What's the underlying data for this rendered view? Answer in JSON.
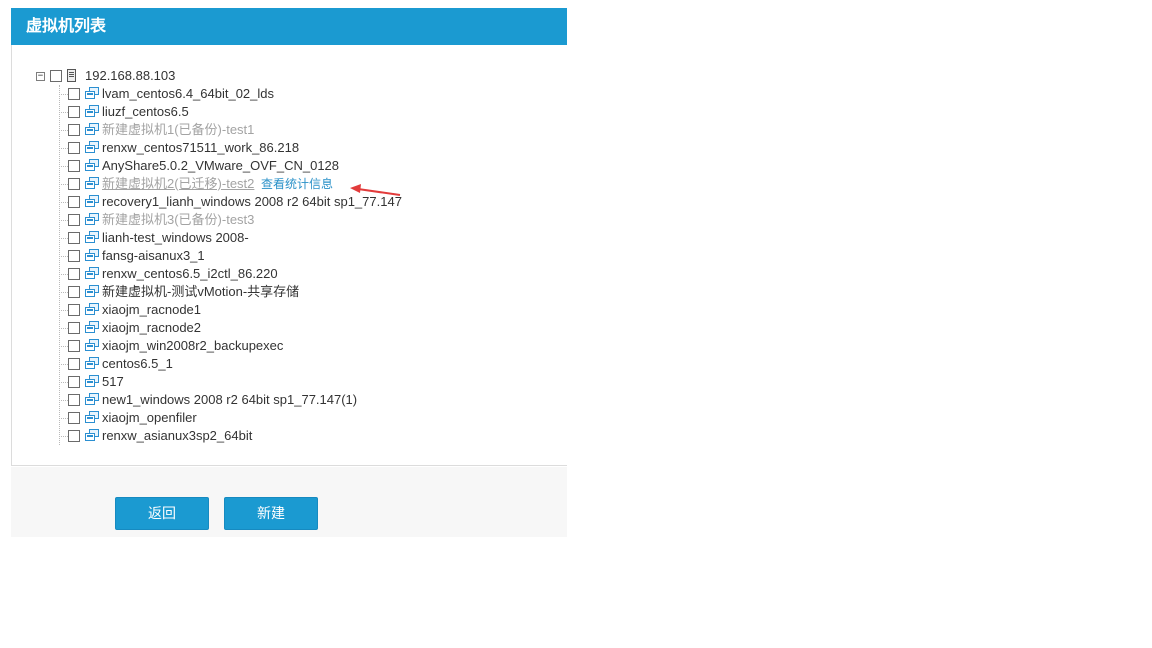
{
  "panel": {
    "title": "虚拟机列表"
  },
  "tree": {
    "root": {
      "label": "192.168.88.103",
      "expander": "−"
    },
    "vms": [
      {
        "label": "lvam_centos6.4_64bit_02_lds",
        "style": "normal"
      },
      {
        "label": "liuzf_centos6.5",
        "style": "normal"
      },
      {
        "label": "新建虚拟机1(已备份)-test1",
        "style": "muted"
      },
      {
        "label": "renxw_centos71511_work_86.218",
        "style": "normal"
      },
      {
        "label": "AnyShare5.0.2_VMware_OVF_CN_0128",
        "style": "normal"
      },
      {
        "label": "新建虚拟机2(已迁移)-test2",
        "style": "muted-underline",
        "link": "查看统计信息"
      },
      {
        "label": "recovery1_lianh_windows 2008 r2 64bit sp1_77.147",
        "style": "normal"
      },
      {
        "label": "新建虚拟机3(已备份)-test3",
        "style": "muted"
      },
      {
        "label": "lianh-test_windows 2008-",
        "style": "normal"
      },
      {
        "label": "fansg-aisanux3_1",
        "style": "normal"
      },
      {
        "label": "renxw_centos6.5_i2ctl_86.220",
        "style": "normal"
      },
      {
        "label": "新建虚拟机-测试vMotion-共享存储",
        "style": "normal"
      },
      {
        "label": "xiaojm_racnode1",
        "style": "normal"
      },
      {
        "label": "xiaojm_racnode2",
        "style": "normal"
      },
      {
        "label": "xiaojm_win2008r2_backupexec",
        "style": "normal"
      },
      {
        "label": "centos6.5_1",
        "style": "normal"
      },
      {
        "label": "517",
        "style": "normal"
      },
      {
        "label": "new1_windows 2008 r2 64bit sp1_77.147(1)",
        "style": "normal"
      },
      {
        "label": "xiaojm_openfiler",
        "style": "normal"
      },
      {
        "label": "renxw_asianux3sp2_64bit",
        "style": "normal"
      }
    ]
  },
  "footer": {
    "back_label": "返回",
    "new_label": "新建"
  },
  "colors": {
    "header": "#1b9ad1",
    "link": "#2a91c8",
    "arrow": "#e23b3b",
    "muted": "#a3a3a3"
  }
}
